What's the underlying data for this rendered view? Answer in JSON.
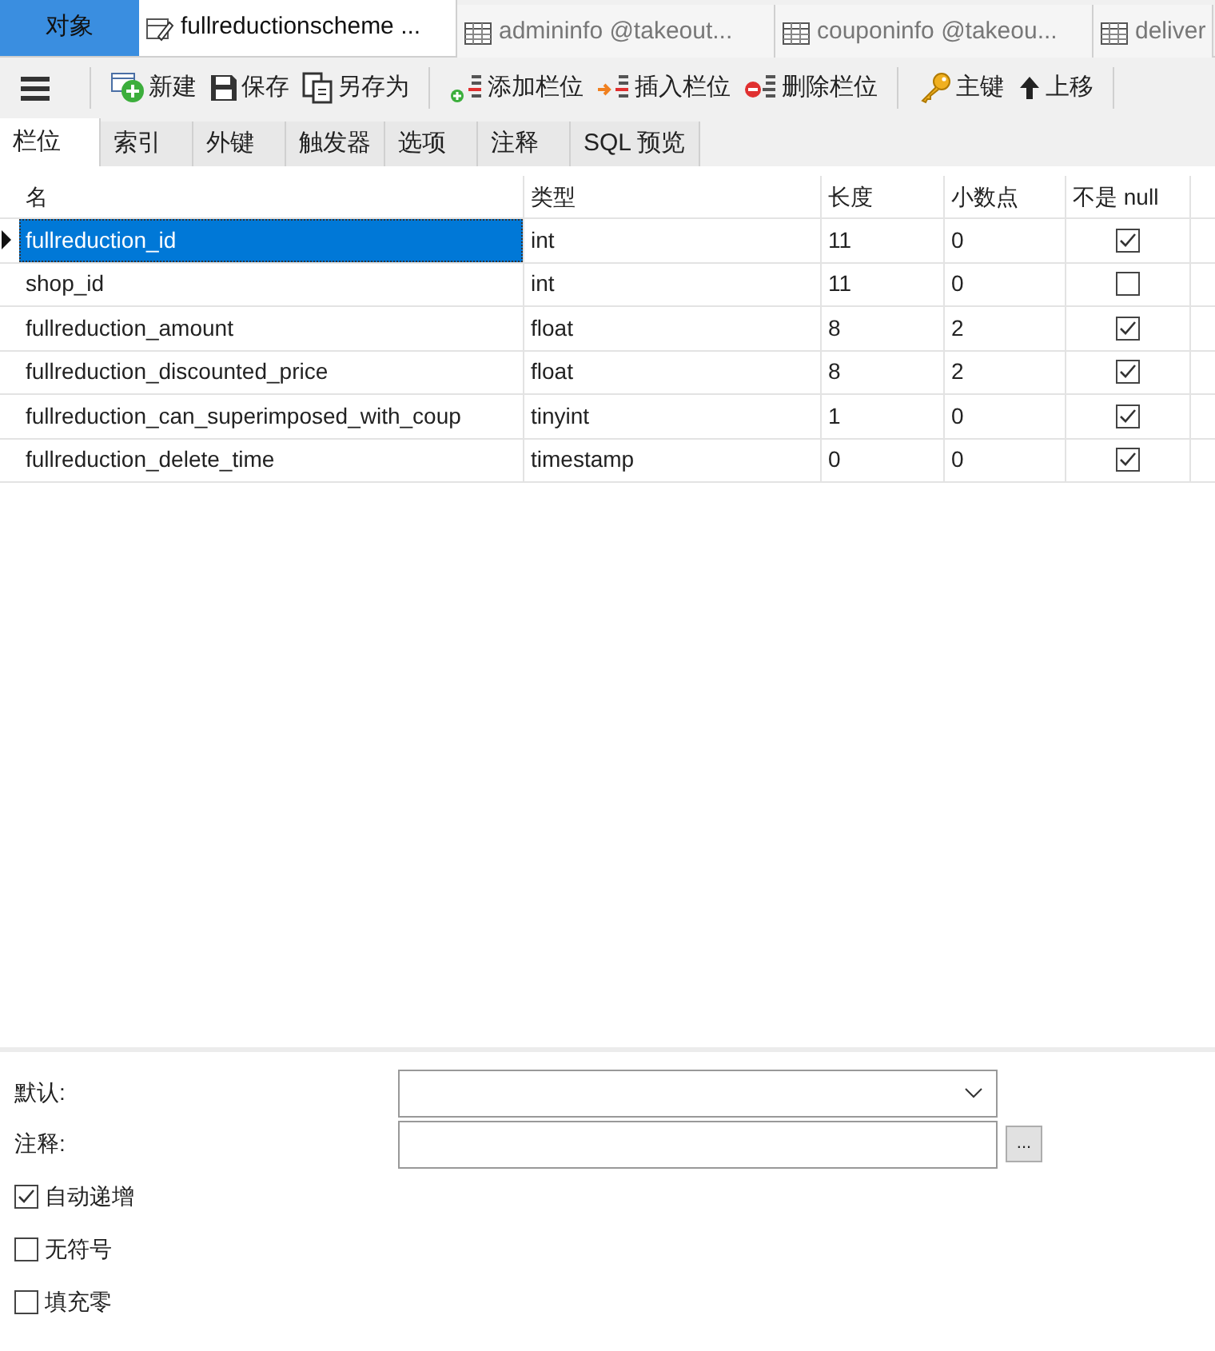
{
  "object_tab": {
    "label": "对象"
  },
  "doc_tabs": [
    {
      "label": "fullreductionscheme ...",
      "kind": "design",
      "selected": true
    },
    {
      "label": "admininfo @takeout...",
      "kind": "table",
      "selected": false
    },
    {
      "label": "couponinfo @takeou...",
      "kind": "table",
      "selected": false
    },
    {
      "label": "deliver",
      "kind": "table",
      "selected": false
    }
  ],
  "toolbar": [
    {
      "kind": "menu"
    },
    {
      "kind": "new",
      "label": "新建"
    },
    {
      "kind": "save",
      "label": "保存"
    },
    {
      "kind": "saveas",
      "label": "另存为"
    },
    {
      "kind": "add",
      "label": "添加栏位"
    },
    {
      "kind": "insert",
      "label": "插入栏位"
    },
    {
      "kind": "delete",
      "label": "删除栏位"
    },
    {
      "kind": "key",
      "label": "主键"
    },
    {
      "kind": "up",
      "label": "上移"
    }
  ],
  "sub_tabs": [
    {
      "label": "栏位",
      "selected": true
    },
    {
      "label": "索引",
      "selected": false
    },
    {
      "label": "外键",
      "selected": false
    },
    {
      "label": "触发器",
      "selected": false
    },
    {
      "label": "选项",
      "selected": false
    },
    {
      "label": "注释",
      "selected": false
    },
    {
      "label": "SQL 预览",
      "selected": false
    }
  ],
  "table": {
    "columns": [
      "名",
      "类型",
      "长度",
      "小数点",
      "不是 null"
    ],
    "rows": [
      {
        "name": "fullreduction_id",
        "type": "int",
        "length": "11",
        "decimals": "0",
        "not_null": true,
        "selected": true
      },
      {
        "name": "shop_id",
        "type": "int",
        "length": "11",
        "decimals": "0",
        "not_null": false,
        "selected": false
      },
      {
        "name": "fullreduction_amount",
        "type": "float",
        "length": "8",
        "decimals": "2",
        "not_null": true,
        "selected": false
      },
      {
        "name": "fullreduction_discounted_price",
        "type": "float",
        "length": "8",
        "decimals": "2",
        "not_null": true,
        "selected": false
      },
      {
        "name": "fullreduction_can_superimposed_with_coup",
        "type": "tinyint",
        "length": "1",
        "decimals": "0",
        "not_null": true,
        "selected": false
      },
      {
        "name": "fullreduction_delete_time",
        "type": "timestamp",
        "length": "0",
        "decimals": "0",
        "not_null": true,
        "selected": false
      }
    ]
  },
  "properties": {
    "default_label": "默认:",
    "comment_label": "注释:",
    "ellipsis": "...",
    "options": [
      {
        "label": "自动递增",
        "checked": true
      },
      {
        "label": "无符号",
        "checked": false
      },
      {
        "label": "填充零",
        "checked": false
      }
    ]
  }
}
